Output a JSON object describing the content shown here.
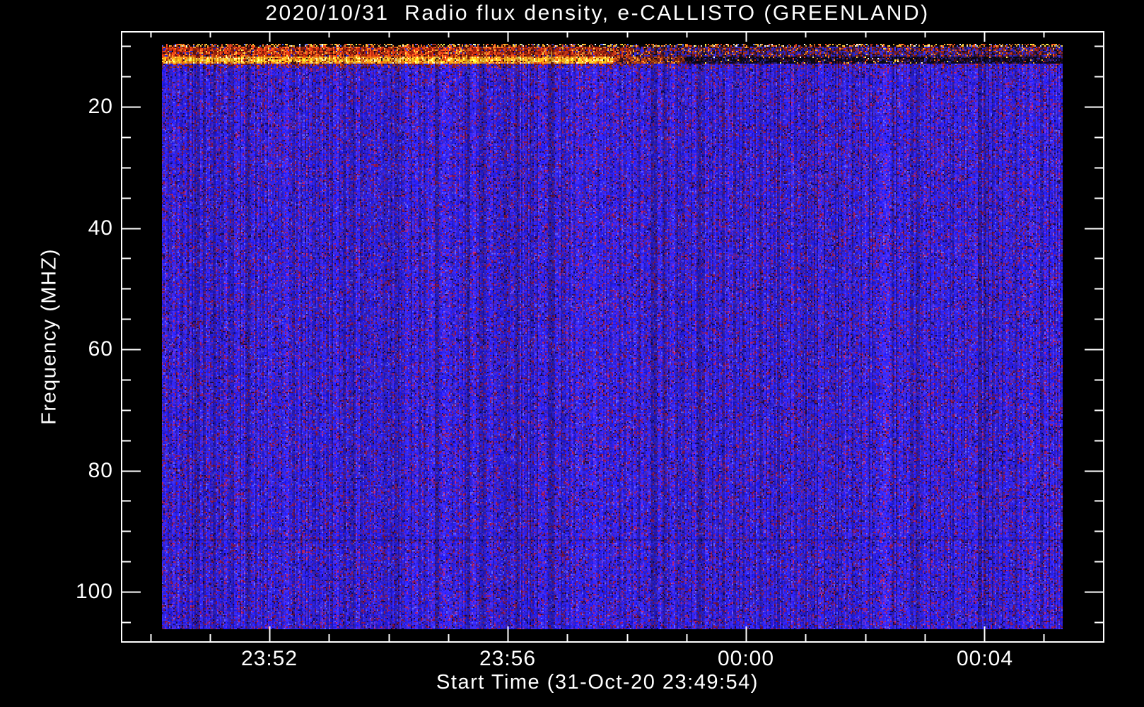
{
  "chart_data": {
    "type": "heatmap",
    "title": "2020/10/31  Radio flux density, e-CALLISTO (GREENLAND)",
    "xlabel": "Start Time (31-Oct-20 23:49:54)",
    "ylabel": "Frequency (MHZ)",
    "x_tick_labels": [
      "23:52",
      "23:56",
      "00:00",
      "00:04"
    ],
    "x_minor_ticks_per_major": 4,
    "x_start_time": "23:49:54",
    "y_tick_labels": [
      "20",
      "40",
      "60",
      "80",
      "100"
    ],
    "y_major_values_mhz": [
      20,
      40,
      60,
      80,
      100
    ],
    "y_minor_step_mhz": 5,
    "y_axis_inverted": true,
    "y_data_range_mhz": [
      10,
      106
    ],
    "grid": false,
    "legend": false,
    "noise_seed": 42,
    "palette": {
      "background": "#000000",
      "frame": "#ffffff",
      "text": "#ffffff",
      "body_blue": "#2a1ee0",
      "body_purple": "#5a2aa0",
      "speckle_maroon": "#8a1430",
      "burst_dark_red": "#8c1908",
      "burst_red": "#d23010",
      "burst_orange": "#ff8c1e",
      "burst_yellow": "#ffd24a",
      "burst_white": "#fff0a0"
    },
    "features": [
      {
        "name": "top-speckle-row",
        "freq_mhz": 10,
        "desc": "multicolor dotted first scan row on black"
      },
      {
        "name": "rfi-red-band",
        "freq_mhz": "10-12",
        "desc": "red interference band, strongest on left half"
      },
      {
        "name": "bright-orange-line",
        "freq_mhz": "12-13",
        "desc": "bright orange-yellow line over left half"
      },
      {
        "name": "dark-lane",
        "freq_mhz": "12-14",
        "desc": "dark band on right half with sparse bright red/orange dashes"
      },
      {
        "name": "body-noise",
        "freq_mhz": "14-106",
        "desc": "uniform blue noise with maroon/purple speckles"
      }
    ]
  }
}
